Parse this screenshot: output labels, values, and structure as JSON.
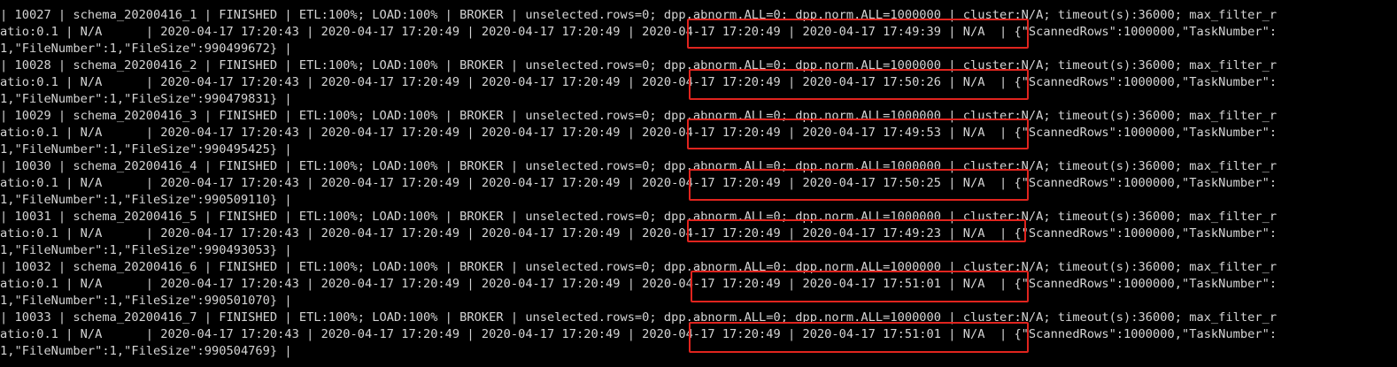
{
  "window": {
    "title": ""
  },
  "highlight_color": "#e0241e",
  "text_color": "#d4d4d4",
  "background_color": "#000000",
  "rows": [
    {
      "line1": "| 10027 | schema_20200416_1 | FINISHED | ETL:100%; LOAD:100% | BROKER | unselected.rows=0; dpp.abnorm.ALL=0; dpp.norm.ALL=1000000 | cluster:N/A; timeout(s):36000; max_filter_r",
      "line2": "atio:0.1 | N/A      | 2020-04-17 17:20:43 | 2020-04-17 17:20:49 | 2020-04-17 17:20:49 | 2020-04-17 17:20:49 | 2020-04-17 17:49:39 | N/A  | {\"ScannedRows\":1000000,\"TaskNumber\":",
      "line3": "1,\"FileNumber\":1,\"FileSize\":990499672} |"
    },
    {
      "line1": "| 10028 | schema_20200416_2 | FINISHED | ETL:100%; LOAD:100% | BROKER | unselected.rows=0; dpp.abnorm.ALL=0; dpp.norm.ALL=1000000 | cluster:N/A; timeout(s):36000; max_filter_r",
      "line2": "atio:0.1 | N/A      | 2020-04-17 17:20:43 | 2020-04-17 17:20:49 | 2020-04-17 17:20:49 | 2020-04-17 17:20:49 | 2020-04-17 17:50:26 | N/A  | {\"ScannedRows\":1000000,\"TaskNumber\":",
      "line3": "1,\"FileNumber\":1,\"FileSize\":990479831} |"
    },
    {
      "line1": "| 10029 | schema_20200416_3 | FINISHED | ETL:100%; LOAD:100% | BROKER | unselected.rows=0; dpp.abnorm.ALL=0; dpp.norm.ALL=1000000 | cluster:N/A; timeout(s):36000; max_filter_r",
      "line2": "atio:0.1 | N/A      | 2020-04-17 17:20:43 | 2020-04-17 17:20:49 | 2020-04-17 17:20:49 | 2020-04-17 17:20:49 | 2020-04-17 17:49:53 | N/A  | {\"ScannedRows\":1000000,\"TaskNumber\":",
      "line3": "1,\"FileNumber\":1,\"FileSize\":990495425} |"
    },
    {
      "line1": "| 10030 | schema_20200416_4 | FINISHED | ETL:100%; LOAD:100% | BROKER | unselected.rows=0; dpp.abnorm.ALL=0; dpp.norm.ALL=1000000 | cluster:N/A; timeout(s):36000; max_filter_r",
      "line2": "atio:0.1 | N/A      | 2020-04-17 17:20:43 | 2020-04-17 17:20:49 | 2020-04-17 17:20:49 | 2020-04-17 17:20:49 | 2020-04-17 17:50:25 | N/A  | {\"ScannedRows\":1000000,\"TaskNumber\":",
      "line3": "1,\"FileNumber\":1,\"FileSize\":990509110} |"
    },
    {
      "line1": "| 10031 | schema_20200416_5 | FINISHED | ETL:100%; LOAD:100% | BROKER | unselected.rows=0; dpp.abnorm.ALL=0; dpp.norm.ALL=1000000 | cluster:N/A; timeout(s):36000; max_filter_r",
      "line2": "atio:0.1 | N/A      | 2020-04-17 17:20:43 | 2020-04-17 17:20:49 | 2020-04-17 17:20:49 | 2020-04-17 17:20:49 | 2020-04-17 17:49:23 | N/A  | {\"ScannedRows\":1000000,\"TaskNumber\":",
      "line3": "1,\"FileNumber\":1,\"FileSize\":990493053} |"
    },
    {
      "line1": "| 10032 | schema_20200416_6 | FINISHED | ETL:100%; LOAD:100% | BROKER | unselected.rows=0; dpp.abnorm.ALL=0; dpp.norm.ALL=1000000 | cluster:N/A; timeout(s):36000; max_filter_r",
      "line2": "atio:0.1 | N/A      | 2020-04-17 17:20:43 | 2020-04-17 17:20:49 | 2020-04-17 17:20:49 | 2020-04-17 17:20:49 | 2020-04-17 17:51:01 | N/A  | {\"ScannedRows\":1000000,\"TaskNumber\":",
      "line3": "1,\"FileNumber\":1,\"FileSize\":990501070} |"
    },
    {
      "line1": "| 10033 | schema_20200416_7 | FINISHED | ETL:100%; LOAD:100% | BROKER | unselected.rows=0; dpp.abnorm.ALL=0; dpp.norm.ALL=1000000 | cluster:N/A; timeout(s):36000; max_filter_r",
      "line2": "atio:0.1 | N/A      | 2020-04-17 17:20:43 | 2020-04-17 17:20:49 | 2020-04-17 17:20:49 | 2020-04-17 17:20:49 | 2020-04-17 17:51:01 | N/A  | {\"ScannedRows\":1000000,\"TaskNumber\":",
      "line3": "1,\"FileNumber\":1,\"FileSize\":990504769} |"
    }
  ]
}
